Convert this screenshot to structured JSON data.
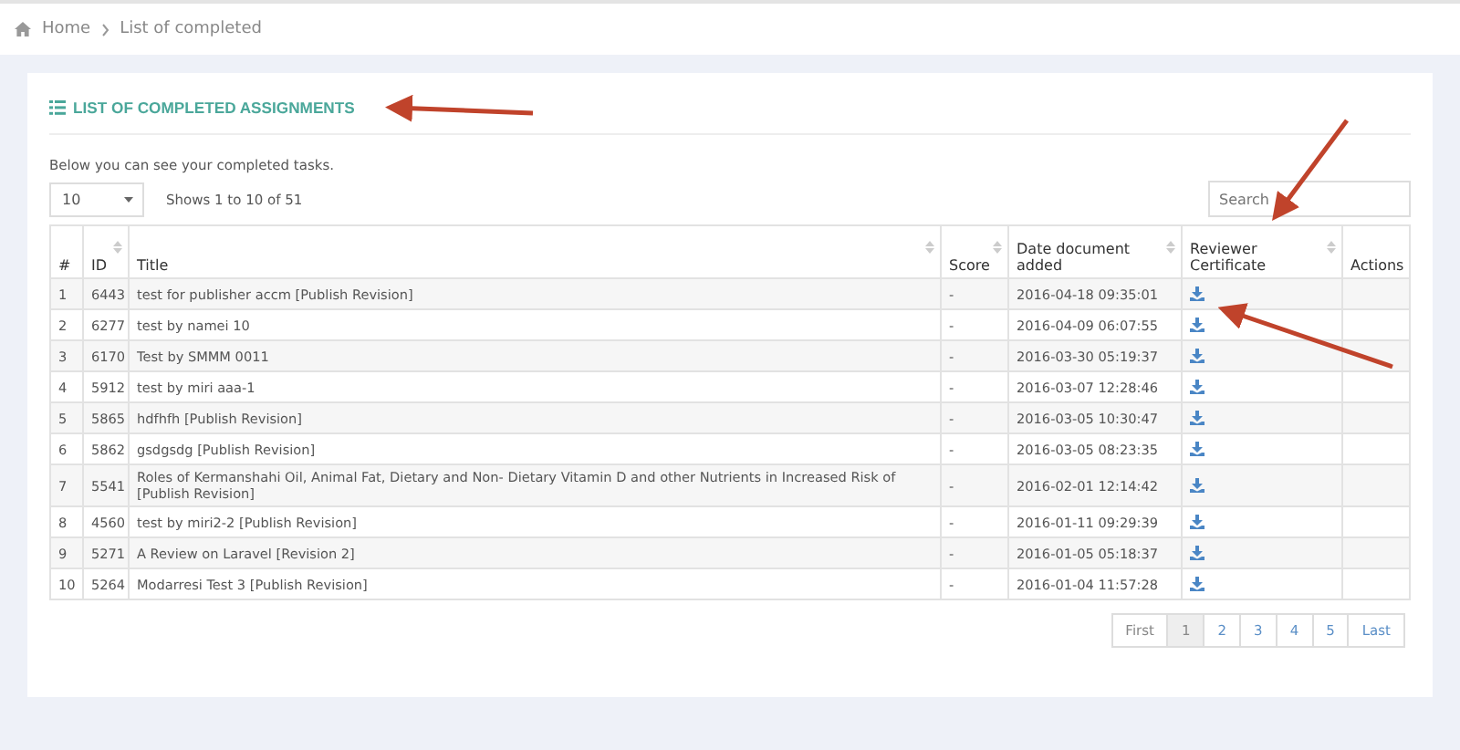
{
  "breadcrumb": [
    {
      "label": "Home"
    },
    {
      "label": "List of completed"
    }
  ],
  "panel": {
    "title": "LIST OF COMPLETED ASSIGNMENTS",
    "description": "Below you can see your completed tasks.",
    "page_size": "10",
    "info": "Shows 1 to 10 of 51",
    "search": {
      "placeholder": "Search"
    },
    "table": {
      "columns": [
        {
          "label": "#",
          "sortable": false
        },
        {
          "label": "ID",
          "sortable": true
        },
        {
          "label": "Title",
          "sortable": true
        },
        {
          "label": "Score",
          "sortable": true
        },
        {
          "label": "Date document added",
          "sortable": true
        },
        {
          "label": "Reviewer Certificate",
          "sortable": true
        },
        {
          "label": "Actions",
          "sortable": false
        }
      ],
      "rows": [
        [
          "1",
          "6443",
          "test for publisher accm [Publish Revision]",
          "-",
          "2016-04-18 09:35:01"
        ],
        [
          "2",
          "6277",
          "test by namei 10",
          "-",
          "2016-04-09 06:07:55"
        ],
        [
          "3",
          "6170",
          "Test by SMMM 0011",
          "-",
          "2016-03-30 05:19:37"
        ],
        [
          "4",
          "5912",
          "test by miri aaa-1",
          "-",
          "2016-03-07 12:28:46"
        ],
        [
          "5",
          "5865",
          "hdfhfh [Publish Revision]",
          "-",
          "2016-03-05 10:30:47"
        ],
        [
          "6",
          "5862",
          "gsdgsdg [Publish Revision]",
          "-",
          "2016-03-05 08:23:35"
        ],
        [
          "7",
          "5541",
          "Roles of Kermanshahi Oil, Animal Fat, Dietary and Non- Dietary Vitamin D and other Nutrients in Increased Risk of [Publish Revision]",
          "-",
          "2016-02-01 12:14:42"
        ],
        [
          "8",
          "4560",
          "test by miri2-2 [Publish Revision]",
          "-",
          "2016-01-11 09:29:39"
        ],
        [
          "9",
          "5271",
          "A Review on Laravel [Revision 2]",
          "-",
          "2016-01-05 05:18:37"
        ],
        [
          "10",
          "5264",
          "Modarresi Test 3 [Publish Revision]",
          "-",
          "2016-01-04 11:57:28"
        ]
      ]
    },
    "pagination": [
      {
        "label": "First",
        "selected": false
      },
      {
        "label": "1",
        "selected": true
      },
      {
        "label": "2",
        "selected": false
      },
      {
        "label": "3",
        "selected": false
      },
      {
        "label": "4",
        "selected": false
      },
      {
        "label": "5",
        "selected": false
      },
      {
        "label": "Last",
        "selected": false
      }
    ]
  }
}
